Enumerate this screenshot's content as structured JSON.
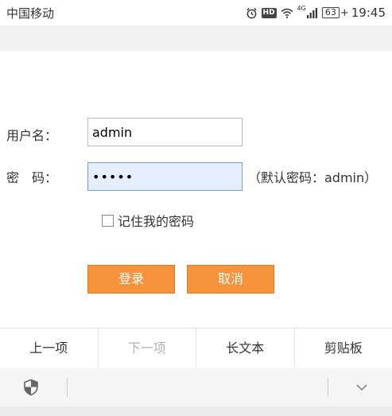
{
  "status_bar": {
    "carrier": "中国移动",
    "network": "4G",
    "battery": "63",
    "time": "19:45",
    "icons": [
      "alarm-icon",
      "hd-icon",
      "wifi-icon",
      "signal-icon",
      "battery-icon"
    ]
  },
  "form": {
    "username_label": "用户名：",
    "username_value": "admin",
    "password_label": "密　码：",
    "password_value": "admin",
    "password_hint": "（默认密码：admin）",
    "remember_label": "记住我的密码",
    "remember_checked": false,
    "login_button": "登录",
    "cancel_button": "取消",
    "accent_color": "#f7933a",
    "focus_color": "#e6efff"
  },
  "assist_bar": {
    "items": [
      {
        "label": "上一项",
        "enabled": true
      },
      {
        "label": "下一项",
        "enabled": false
      },
      {
        "label": "长文本",
        "enabled": true
      },
      {
        "label": "剪贴板",
        "enabled": true
      }
    ]
  },
  "bottom_bar": {
    "icons": [
      "shield-icon",
      "chevron-down-icon"
    ]
  }
}
